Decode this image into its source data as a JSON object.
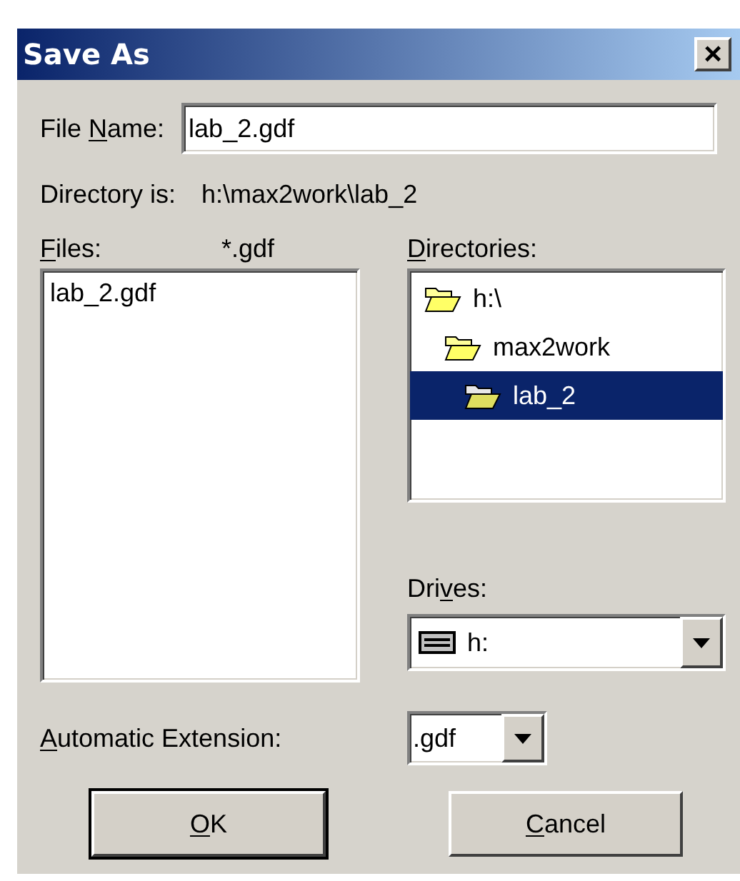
{
  "window": {
    "title": "Save As",
    "close": "×"
  },
  "file_name": {
    "label": {
      "pre": "File ",
      "key": "N",
      "post": "ame:"
    },
    "value": "lab_2.gdf"
  },
  "directory": {
    "label": "Directory is:",
    "value": "h:\\max2work\\lab_2"
  },
  "files": {
    "label": {
      "key": "F",
      "post": "iles:"
    },
    "filter": "*.gdf",
    "items": [
      {
        "name": "lab_2.gdf",
        "selected": false
      }
    ]
  },
  "directories": {
    "label": {
      "key": "D",
      "post": "irectories:"
    },
    "tree": [
      {
        "name": "h:\\",
        "selected": false,
        "children": [
          {
            "name": "max2work",
            "selected": false,
            "children": [
              {
                "name": "lab_2",
                "selected": true
              }
            ]
          }
        ]
      }
    ]
  },
  "drives": {
    "label": {
      "pre": "Dri",
      "key": "v",
      "post": "es:"
    },
    "value": "h:"
  },
  "extension": {
    "label": {
      "key": "A",
      "post": "utomatic Extension:"
    },
    "value": ".gdf"
  },
  "buttons": [
    {
      "label": {
        "key": "O",
        "post": "K"
      },
      "default": true
    },
    {
      "label": {
        "key": "C",
        "post": "ancel"
      },
      "default": false
    }
  ]
}
